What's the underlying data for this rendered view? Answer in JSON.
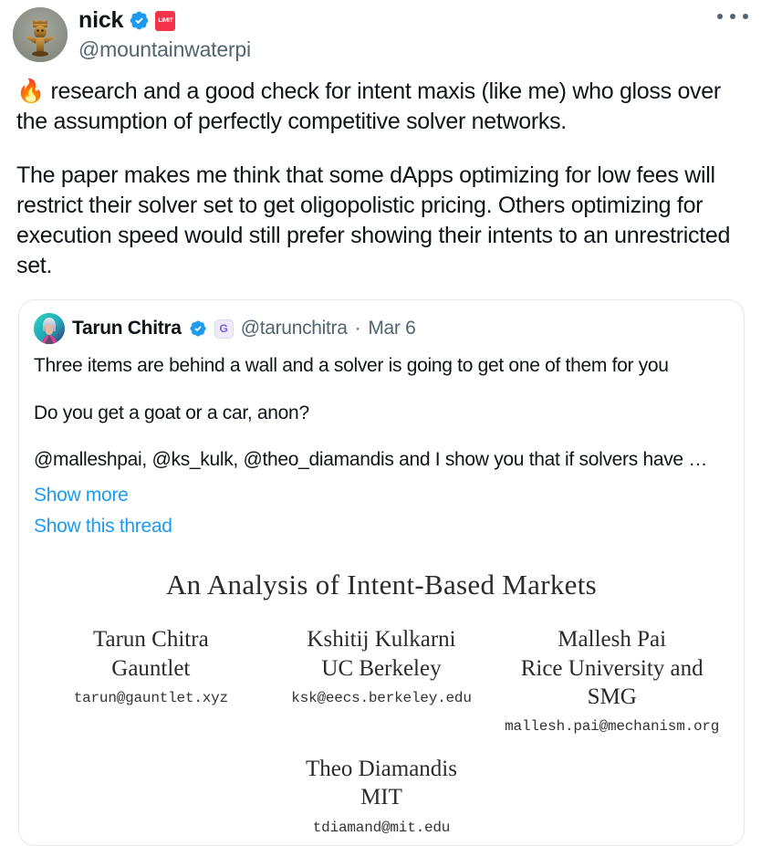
{
  "author": {
    "display_name": "nick",
    "handle": "@mountainwaterpi",
    "verified_badge": "verified-badge-blue",
    "affiliate_badge_label": "LIMIT",
    "affiliate_badge_color": "#f4334a",
    "avatar_alt": "golden-figurine-avatar"
  },
  "actions": {
    "more_label": "more-options"
  },
  "tweet": {
    "paragraph_1": "🔥 research and a good check for intent maxis (like me) who gloss over the assumption of perfectly competitive solver networks.",
    "paragraph_2": "The paper makes me think that some dApps optimizing for low fees will restrict their solver set to get oligopolistic pricing. Others optimizing for execution speed would still prefer showing their intents to an unrestricted set."
  },
  "quoted_tweet": {
    "display_name": "Tarun Chitra",
    "verified_badge": "verified-badge-blue",
    "affiliate_badge_label": "G",
    "affiliate_badge_color": "#7b5ed7",
    "handle": "@tarunchitra",
    "separator": "·",
    "date": "Mar 6",
    "avatar_alt": "anime-character-avatar",
    "paragraph_1": "Three items are behind a wall and a solver is going to get one of them for you",
    "paragraph_2": "Do you get a goat or a car, anon?",
    "paragraph_3": "@malleshpai, @ks_kulk, @theo_diamandis and I show you that if solvers have …",
    "show_more_label": "Show more",
    "show_thread_label": "Show this thread",
    "link_color": "#1d9bf0"
  },
  "paper": {
    "title": "An Analysis of Intent-Based Markets",
    "authors_row": [
      {
        "name": "Tarun Chitra",
        "affiliation": "Gauntlet",
        "email": "tarun@gauntlet.xyz"
      },
      {
        "name": "Kshitij Kulkarni",
        "affiliation": "UC Berkeley",
        "email": "ksk@eecs.berkeley.edu"
      },
      {
        "name": "Mallesh Pai",
        "affiliation": "Rice University and SMG",
        "email": "mallesh.pai@mechanism.org"
      }
    ],
    "author_last": {
      "name": "Theo Diamandis",
      "affiliation": "MIT",
      "email": "tdiamand@mit.edu"
    }
  }
}
